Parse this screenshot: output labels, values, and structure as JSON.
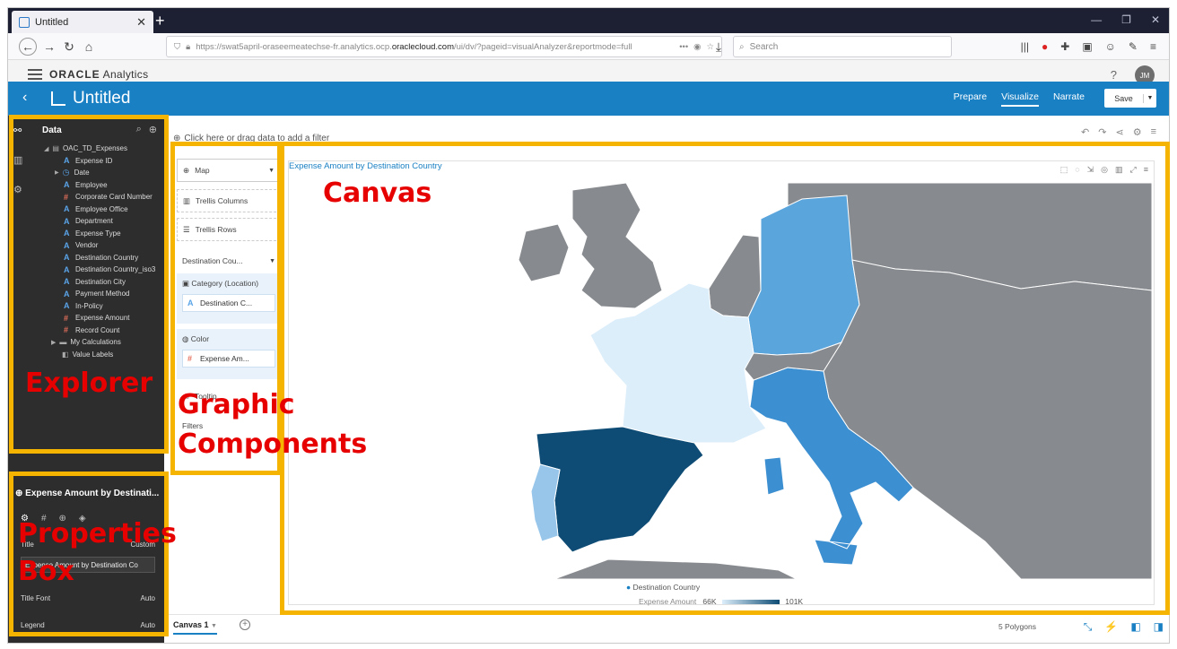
{
  "browser": {
    "tab_title": "Untitled",
    "tab_close": "✕",
    "new_tab": "+",
    "url_prefix": "https://swat5april-oraseemeatechse-fr.analytics.ocp.",
    "url_host": "oraclecloud.com",
    "url_suffix": "/ui/dv/?pageid=visualAnalyzer&reportmode=full",
    "url_more": "•••",
    "search_placeholder": "Search"
  },
  "app": {
    "brand_oracle": "ORACLE",
    "brand_product": "Analytics",
    "help": "?",
    "user_initials": "JM"
  },
  "titlebar": {
    "back": "‹",
    "project_title": "Untitled",
    "modes": [
      "Prepare",
      "Visualize",
      "Narrate"
    ],
    "active_mode": "Visualize",
    "save_label": "Save",
    "save_caret": "▼"
  },
  "explorer": {
    "header": "Data",
    "dataset": "OAC_TD_Expenses",
    "items": [
      {
        "glyph": "A",
        "label": "Expense ID"
      },
      {
        "glyph": "clock",
        "label": "Date"
      },
      {
        "glyph": "A",
        "label": "Employee"
      },
      {
        "glyph": "#",
        "label": "Corporate Card Number"
      },
      {
        "glyph": "A",
        "label": "Employee Office"
      },
      {
        "glyph": "A",
        "label": "Department"
      },
      {
        "glyph": "A",
        "label": "Expense Type"
      },
      {
        "glyph": "A",
        "label": "Vendor"
      },
      {
        "glyph": "A",
        "label": "Destination Country"
      },
      {
        "glyph": "A",
        "label": "Destination Country_iso3"
      },
      {
        "glyph": "A",
        "label": "Destination City"
      },
      {
        "glyph": "A",
        "label": "Payment Method"
      },
      {
        "glyph": "A",
        "label": "In-Policy"
      },
      {
        "glyph": "#",
        "label": "Expense Amount"
      },
      {
        "glyph": "#",
        "label": "Record Count"
      }
    ],
    "my_calculations": "My Calculations",
    "value_labels": "Value Labels"
  },
  "properties": {
    "title": "Expense Amount by Destinati...",
    "title_row_label": "Title",
    "title_row_value": "Custom",
    "title_value": "Expense Amount by Destination Co",
    "title_font_label": "Title Font",
    "title_font_value": "Auto",
    "legend_label": "Legend",
    "legend_value": "Auto"
  },
  "grammar": {
    "viz_type": "Map",
    "trellis_columns": "Trellis Columns",
    "trellis_rows": "Trellis Rows",
    "layer": "Destination Cou...",
    "category_label": "Category (Location)",
    "category_chip": "Destination C...",
    "color_label": "Color",
    "color_chip": "Expense Am...",
    "tooltip": "Tooltip",
    "filters": "Filters"
  },
  "filter_bar": {
    "text": "Click here or drag data to add a filter"
  },
  "viz": {
    "title": "Expense Amount by Destination Country",
    "legend_series": "Destination Country",
    "legend_measure": "Expense Amount",
    "legend_min": "66K",
    "legend_max": "101K",
    "colored_countries": [
      {
        "name": "Spain",
        "shade": "darkest",
        "color": "#0e4c75"
      },
      {
        "name": "Italy",
        "shade": "medium",
        "color": "#3c8fd1"
      },
      {
        "name": "Germany",
        "shade": "medium",
        "color": "#5ba5dd"
      },
      {
        "name": "Portugal",
        "shade": "light",
        "color": "#97c6ea"
      },
      {
        "name": "France",
        "shade": "lightest",
        "color": "#dceefa"
      }
    ],
    "other_land_color": "#878a8e"
  },
  "bottom": {
    "canvas_tab": "Canvas 1",
    "canvas_caret": "▼",
    "add": "+",
    "polygons": "5 Polygons"
  },
  "annotations": {
    "canvas": "Canvas",
    "explorer": "Explorer",
    "graphic_1": "Graphic",
    "graphic_2": "Components",
    "properties_1": "Properties",
    "properties_2": "Box",
    "color": "#f5b400",
    "label_color": "#e60000"
  }
}
